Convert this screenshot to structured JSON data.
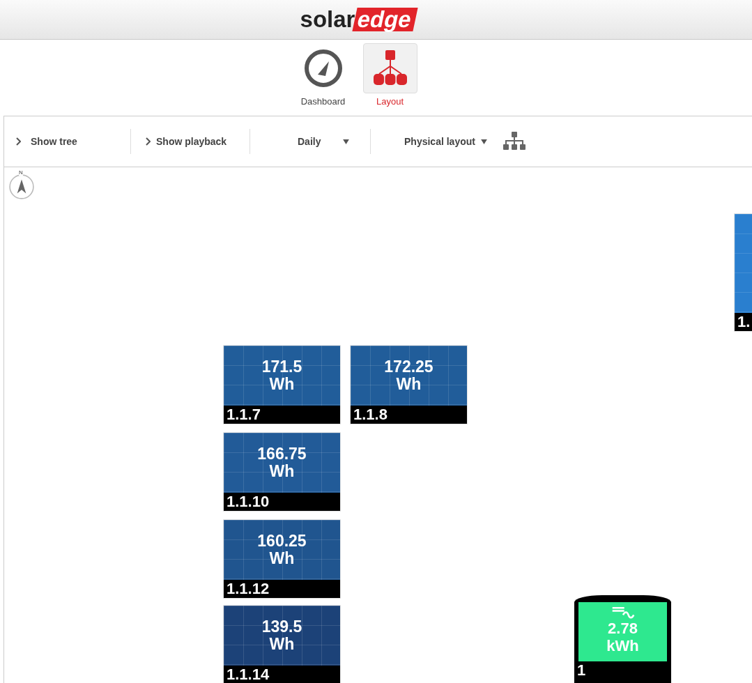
{
  "logo": {
    "part_1": "solar",
    "part_2": "edge"
  },
  "nav": [
    {
      "label": "Dashboard",
      "kind": "gauge",
      "selected": false
    },
    {
      "label": "Layout",
      "kind": "layout",
      "selected": true
    }
  ],
  "toolbar": {
    "show_tree": "Show tree",
    "show_playback": "Show playback",
    "period": "Daily",
    "view": "Physical layout"
  },
  "compass": {
    "label": "N"
  },
  "panels": [
    {
      "value": "171.5",
      "unit": "Wh",
      "id": "1.1.7",
      "color": "#215d9a"
    },
    {
      "value": "172.25",
      "unit": "Wh",
      "id": "1.1.8",
      "color": "#215d9a"
    },
    {
      "value": "166.75",
      "unit": "Wh",
      "id": "1.1.10",
      "color": "#225b98"
    },
    {
      "value": "160.25",
      "unit": "Wh",
      "id": "1.1.12",
      "color": "#20558f"
    },
    {
      "value": "139.5",
      "unit": "Wh",
      "id": "1.1.14",
      "color": "#1c4278"
    },
    {
      "id": "1.",
      "color": "#2a7fcf"
    }
  ],
  "inverter": {
    "value": "2.78",
    "unit": "kWh",
    "id": "1",
    "color": "#2ee88f"
  }
}
